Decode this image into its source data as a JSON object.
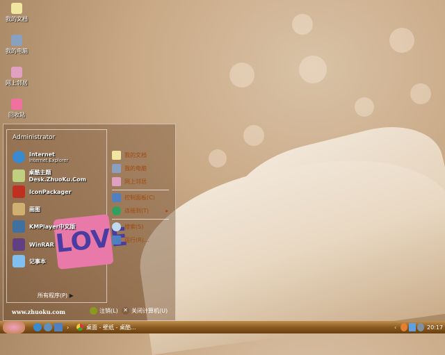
{
  "desktop": {
    "icons": [
      {
        "label": "我的文档"
      },
      {
        "label": "我的电脑"
      },
      {
        "label": "网上邻居"
      },
      {
        "label": "回收站"
      }
    ]
  },
  "start_menu": {
    "user": "Administrator",
    "programs": [
      {
        "name": "Internet",
        "sub": "Internet Explorer"
      },
      {
        "name": "桌酷主题Desk.ZhuoKu.Com"
      },
      {
        "name": "IconPackager"
      },
      {
        "name": "画图"
      },
      {
        "name": "KMPlayer中文版"
      },
      {
        "name": "WinRAR"
      },
      {
        "name": "记事本"
      }
    ],
    "all_programs": "所有程序(P)",
    "places": [
      "我的文档",
      "我的电脑",
      "网上邻居"
    ],
    "system": [
      "控制面板(C)",
      "连接到(T)"
    ],
    "tools": [
      "搜索(S)",
      "运行(R)..."
    ],
    "footer_site": "www.zhuoku.com",
    "logoff": "注销(L)",
    "shutdown": "关闭计算机(U)",
    "art_text": "LOVE"
  },
  "taskbar": {
    "window_title": "桌面 - 壁纸 - 桌酷...",
    "clock": "20:17"
  }
}
